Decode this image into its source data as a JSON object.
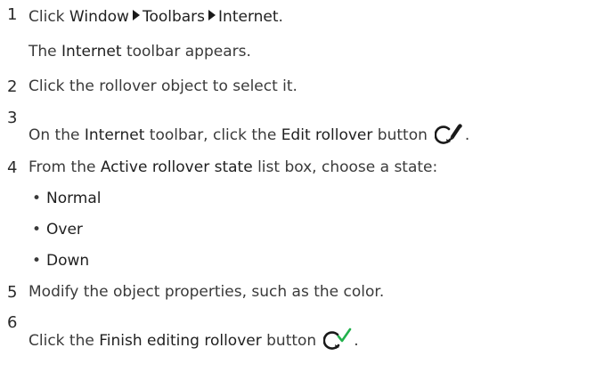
{
  "steps": [
    {
      "number": "1",
      "parts": {
        "prefix": "Click ",
        "menu1": "Window",
        "menu2": "Toolbars",
        "menu3": "Internet",
        "suffix": "."
      },
      "result": {
        "prefix": "The ",
        "ui": "Internet",
        "suffix": " toolbar appears."
      }
    },
    {
      "number": "2",
      "text": "Click the rollover object to select it."
    },
    {
      "number": "3",
      "parts": {
        "prefix": "On the ",
        "ui1": "Internet",
        "middle": " toolbar, click the ",
        "ui2": "Edit rollover",
        "suffix": " button",
        "end": "."
      },
      "icon": "edit-rollover-icon"
    },
    {
      "number": "4",
      "parts": {
        "prefix": "From the ",
        "ui": "Active rollover state",
        "suffix": " list box, choose a state:"
      },
      "options": [
        "Normal",
        "Over",
        "Down"
      ]
    },
    {
      "number": "5",
      "text": "Modify the object properties, such as the color."
    },
    {
      "number": "6",
      "parts": {
        "prefix": "Click the ",
        "ui": "Finish editing rollover",
        "suffix": " button",
        "end": "."
      },
      "icon": "finish-editing-rollover-icon"
    }
  ],
  "colors": {
    "text": "#3a3a3a",
    "ui_text": "#1f1f1f",
    "check_green": "#22b14c"
  }
}
